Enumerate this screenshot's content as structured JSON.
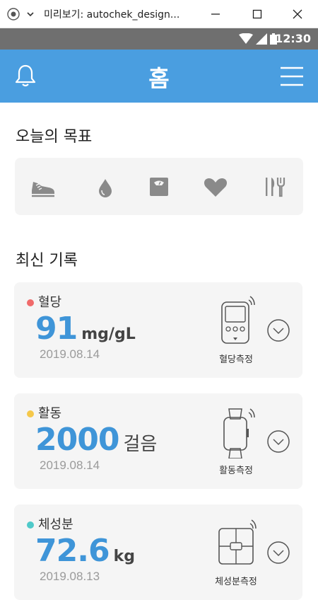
{
  "window": {
    "title": "미리보기: autochek_design..."
  },
  "status_bar": {
    "time": "12:30"
  },
  "header": {
    "title": "홈"
  },
  "goals_section": {
    "title": "오늘의 목표",
    "items": [
      {
        "name": "activity",
        "icon": "shoe-icon"
      },
      {
        "name": "blood-sugar",
        "icon": "drop-icon"
      },
      {
        "name": "body-composition",
        "icon": "scale-icon"
      },
      {
        "name": "heart",
        "icon": "heart-icon"
      },
      {
        "name": "meal",
        "icon": "fork-knife-icon"
      }
    ]
  },
  "records_section": {
    "title": "최신 기록",
    "cards": [
      {
        "label": "혈당",
        "value": "91",
        "unit": "mg/gL",
        "date": "2019.08.14",
        "device_label": "혈당측정",
        "dot_color": "#f06a6a"
      },
      {
        "label": "활동",
        "value": "2000",
        "unit": "걸음",
        "date": "2019.08.14",
        "device_label": "활동측정",
        "dot_color": "#f5c84a"
      },
      {
        "label": "체성분",
        "value": "72.6",
        "unit": "kg",
        "date": "2019.08.13",
        "device_label": "체성분측정",
        "dot_color": "#4fc9c9"
      }
    ]
  },
  "colors": {
    "primary": "#4a9ee0",
    "value_blue": "#3f95d8",
    "status_bar": "#6f6f6f"
  }
}
